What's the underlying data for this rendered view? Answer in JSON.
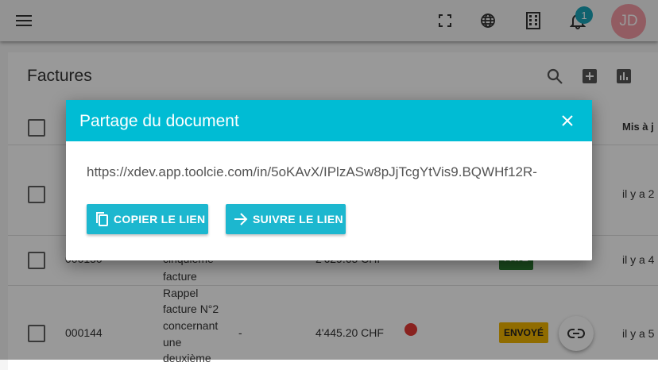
{
  "topbar": {
    "avatar_initials": "JD",
    "notification_count": "1",
    "icons": [
      "menu-icon",
      "fullscreen-icon",
      "globe-icon",
      "building-icon",
      "bell-icon"
    ]
  },
  "page": {
    "title": "Factures",
    "column_header_last": "Mis à j"
  },
  "rows": [
    {
      "updated": "il y a 2"
    },
    {
      "number": "000150",
      "description": [
        "cinquième",
        "facture"
      ],
      "amount": "2'629.65 CHF",
      "status": "PAYÉ",
      "updated": "il y a 4"
    },
    {
      "number": "000144",
      "description": [
        "Rappel",
        "facture N°2",
        "concernant",
        "une",
        "deuxième"
      ],
      "amount_dash": "-",
      "amount": "4'445.20 CHF",
      "status": "ENVOYÉ",
      "updated": "il y a 5"
    }
  ],
  "colors": {
    "dialog_header": "#00bcd4",
    "button": "#1cb7cf",
    "status_sent": "#f0b400",
    "status_paid": "#2e7d32",
    "dot": "#e53935"
  },
  "dialog": {
    "title": "Partage du document",
    "url": "https://xdev.app.toolcie.com/in/5oKAvX/IPlzASw8pJjTcgYtVis9.BQWHf12R-",
    "copy_label": "COPIER LE LIEN",
    "follow_label": "SUIVRE LE LIEN"
  }
}
